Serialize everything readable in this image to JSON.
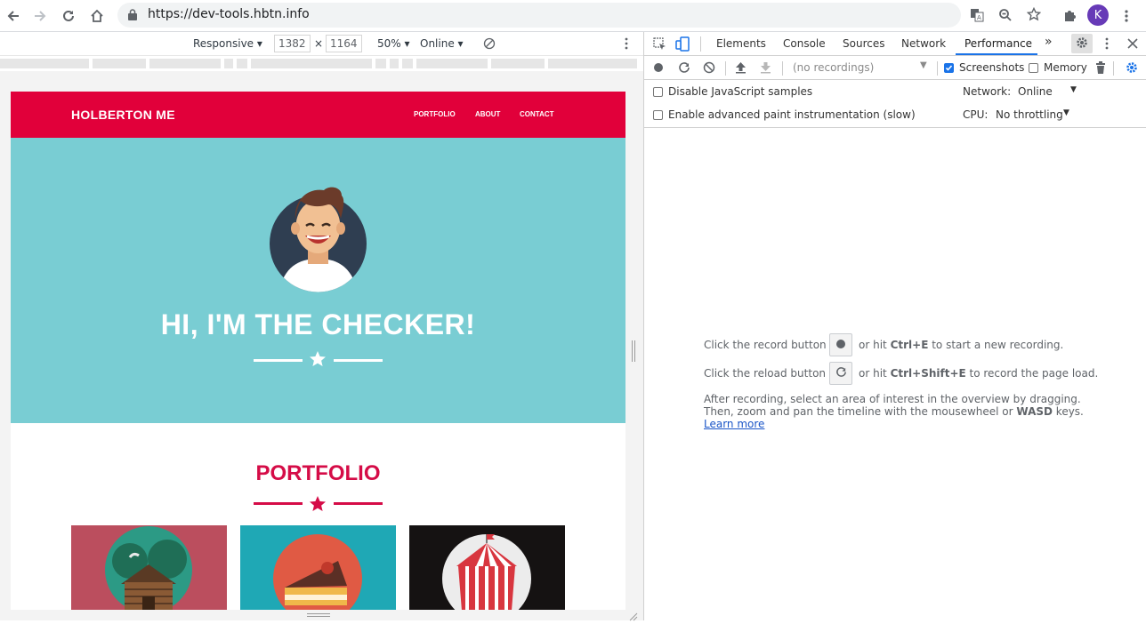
{
  "browser": {
    "url": "https://dev-tools.hbtn.info",
    "profile_initial": "K",
    "accent": "#673ab7"
  },
  "device_toolbar": {
    "mode": "Responsive",
    "width": "1382",
    "times": "×",
    "height": "1164",
    "zoom": "50%",
    "network": "Online"
  },
  "site": {
    "brand": "HOLBERTON ME",
    "nav": [
      "PORTFOLIO",
      "ABOUT",
      "CONTACT"
    ],
    "hero_title": "HI, I'M THE CHECKER!",
    "portfolio_title": "PORTFOLIO",
    "colors": {
      "nav": "#e1003a",
      "hero": "#79cdd3",
      "accent": "#d50c47"
    }
  },
  "devtools": {
    "tabs": [
      "Elements",
      "Console",
      "Sources",
      "Network",
      "Performance"
    ],
    "active_tab": "Performance",
    "more": "»",
    "recordings_placeholder": "(no recordings)",
    "screenshots_label": "Screenshots",
    "screenshots_checked": true,
    "memory_label": "Memory",
    "memory_checked": false,
    "settings": {
      "disable_js": "Disable JavaScript samples",
      "paint": "Enable advanced paint instrumentation (slow)",
      "network_label": "Network:",
      "network_value": "Online",
      "cpu_label": "CPU:",
      "cpu_value": "No throttling"
    },
    "landing": {
      "record_pre": "Click the record button",
      "record_post_a": "or hit ",
      "record_key": "Ctrl+E",
      "record_post_b": " to start a new recording.",
      "reload_pre": "Click the reload button",
      "reload_post_a": "or hit ",
      "reload_key": "Ctrl+Shift+E",
      "reload_post_b": " to record the page load.",
      "after_line1": "After recording, select an area of interest in the overview by dragging.",
      "after_line2a": "Then, zoom and pan the timeline with the mousewheel or ",
      "after_key": "WASD",
      "after_line2b": " keys.",
      "learn_more": "Learn more"
    }
  }
}
